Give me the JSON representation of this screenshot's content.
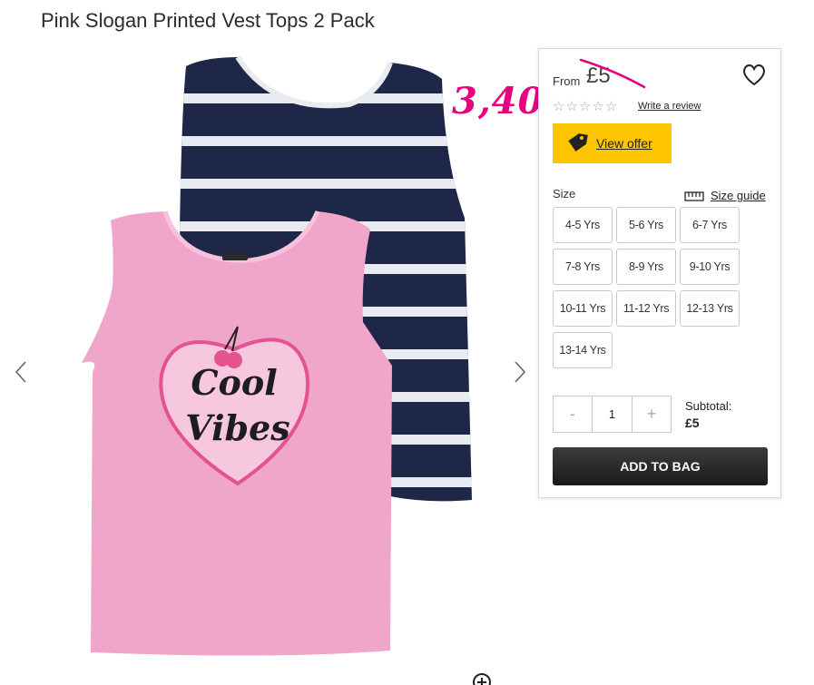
{
  "product": {
    "title": "Pink Slogan Printed Vest Tops 2 Pack",
    "image_text": "Cool Vibes"
  },
  "annotation": {
    "handwritten_price": "3,40",
    "color": "#e6007e"
  },
  "pricing": {
    "from_label": "From",
    "price": "£5"
  },
  "reviews": {
    "stars_filled": 0,
    "stars_total": 5,
    "write_review_label": "Write a review"
  },
  "offer": {
    "label": "View offer",
    "icon": "tag-icon",
    "color": "#fdc500"
  },
  "size": {
    "label": "Size",
    "guide_label": "Size guide",
    "guide_icon": "ruler-icon",
    "options": [
      "4-5 Yrs",
      "5-6 Yrs",
      "6-7 Yrs",
      "7-8 Yrs",
      "8-9 Yrs",
      "9-10 Yrs",
      "10-11 Yrs",
      "11-12 Yrs",
      "12-13 Yrs",
      "13-14 Yrs"
    ]
  },
  "quantity": {
    "minus_label": "-",
    "value": "1",
    "plus_label": "+"
  },
  "subtotal": {
    "label": "Subtotal:",
    "value": "£5"
  },
  "add_to_bag_label": "ADD TO BAG",
  "icons": {
    "wishlist": "heart-icon",
    "prev": "chevron-left-icon",
    "next": "chevron-right-icon",
    "zoom": "zoom-plus-icon"
  }
}
